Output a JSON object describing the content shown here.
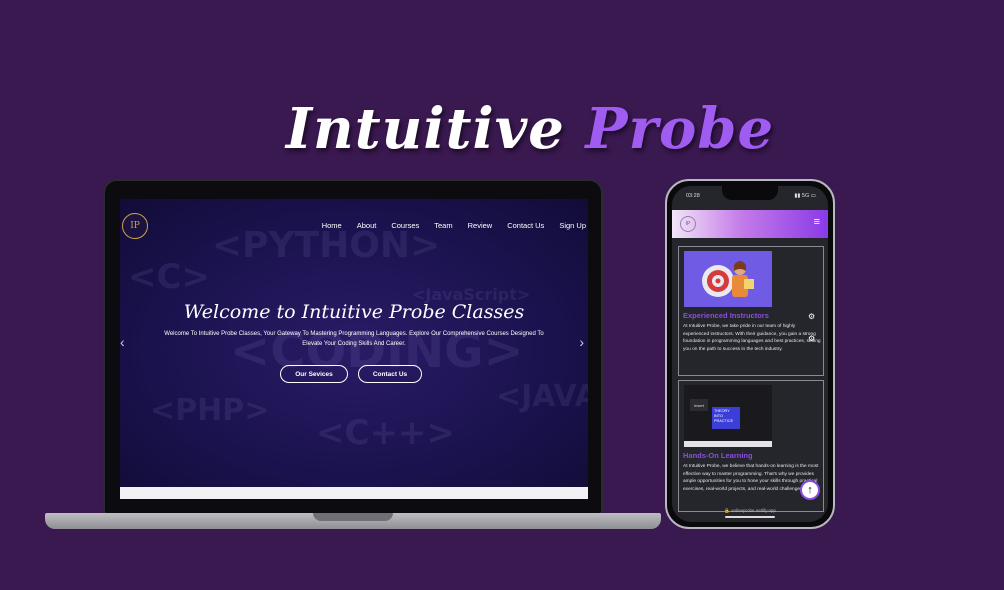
{
  "headline": {
    "word1": "Intuitive",
    "word2": "Probe"
  },
  "laptop": {
    "logo": "IP",
    "nav": [
      "Home",
      "About",
      "Courses",
      "Team",
      "Review",
      "Contact Us",
      "Sign Up"
    ],
    "background_words": [
      "<PYTHON>",
      "<C>",
      "<JavaScript>",
      "<CODING>",
      "<PHP>",
      "<C++>",
      "<JAVA>"
    ],
    "hero_title": "Welcome to Intuitive Probe Classes",
    "hero_subtitle": "Welcome To Intuitive Probe Classes, Your Gateway To Mastering Programming Languages. Explore Our Comprehensive Courses Designed To Elevate Your Coding Skills And Career.",
    "btn_services": "Our Sevices",
    "btn_contact": "Contact Us",
    "prev_icon": "chevron-left-icon",
    "next_icon": "chevron-right-icon"
  },
  "phone": {
    "time": "03:28",
    "signal": "▮▮ 5G ▭",
    "logo": "IP",
    "menu_icon": "hamburger-icon",
    "card1": {
      "title": "Experienced Instructors",
      "text": "At Intuitive Probe, we take pride in our team of highly experienced instructors. With their guidance, you gain a strong foundation in programming languages and best practices, setting you on the path to success in the tech industry."
    },
    "card2": {
      "image_key": "Insert",
      "image_text": "THEORY INTO PRACTICE",
      "title": "Hands-On Learning",
      "text": "At Intuitive Probe, we believe that hands-on learning is the most effective way to master programming. That's why we provides ample opportunities for you to hone your skills through practical exercises, real-world projects, and real-world challenges."
    },
    "url": "🔒 onlineprobe.netlify.app",
    "scroll_top_icon": "arrow-up-icon"
  },
  "colors": {
    "background": "#3a1850",
    "accent": "#a05cf0"
  }
}
